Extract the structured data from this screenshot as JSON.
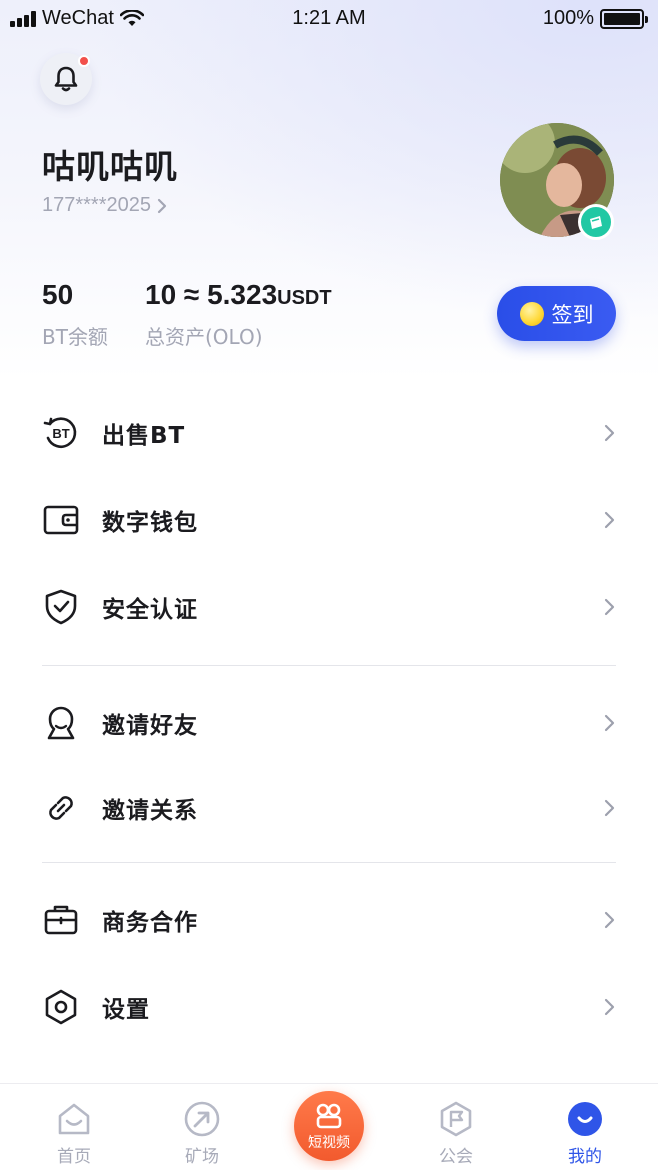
{
  "status_bar": {
    "carrier": "WeChat",
    "time": "1:21 AM",
    "battery": "100%"
  },
  "profile": {
    "name": "咕叽咕叽",
    "phone": "177****2025"
  },
  "stats": {
    "bt_balance_value": "50",
    "bt_balance_label": "BT余额",
    "total_assets_value": "10 ≈ 5.323",
    "total_assets_unit": "USDT",
    "total_assets_label": "总资产(OLO)"
  },
  "checkin": {
    "label": "签到"
  },
  "menu": {
    "sell_bt": "出售BT",
    "wallet": "数字钱包",
    "security": "安全认证",
    "invite_friends": "邀请好友",
    "invite_relations": "邀请关系",
    "business": "商务合作",
    "settings": "设置"
  },
  "tabbar": {
    "home": "首页",
    "mine_field": "矿场",
    "short_video": "短视频",
    "guild": "公会",
    "me": "我的"
  },
  "colors": {
    "accent": "#2f55e8",
    "center_tab": "#f25a2e",
    "badge": "#21c8a4",
    "notification_dot": "#f2504b"
  }
}
